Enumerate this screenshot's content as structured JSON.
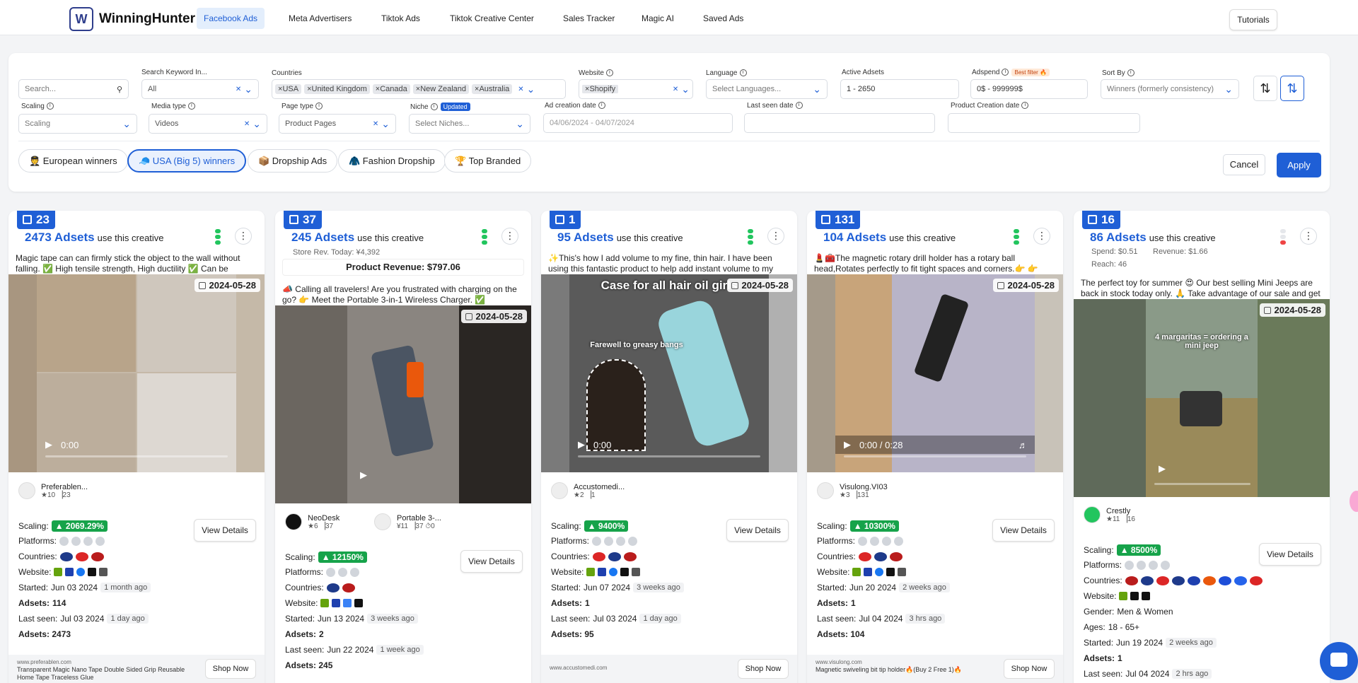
{
  "app": {
    "name": "WinningHunter",
    "tutorials": "Tutorials"
  },
  "nav": [
    "Facebook Ads",
    "Meta Advertisers",
    "Tiktok Ads",
    "Tiktok Creative Center",
    "Sales Tracker",
    "Magic AI",
    "Saved Ads"
  ],
  "filters": {
    "search_placeholder": "Search...",
    "keyword_label": "Search Keyword In...",
    "keyword_value": "All",
    "countries_label": "Countries",
    "countries": [
      "USA",
      "United Kingdom",
      "Canada",
      "New Zealand",
      "Australia"
    ],
    "website_label": "Website",
    "website": "Shopify",
    "language_label": "Language",
    "language_placeholder": "Select Languages...",
    "active_label": "Active Adsets",
    "active_value": "1 - 2650",
    "adspend_label": "Adspend",
    "best_filter": "Best filter 🔥",
    "adspend_value": "0$ - 999999$",
    "sortby_label": "Sort By",
    "sortby_value": "Winners (formerly consistency)",
    "scaling_label": "Scaling",
    "scaling_value": "Scaling",
    "media_label": "Media type",
    "media_value": "Videos",
    "pagetype_label": "Page type",
    "pagetype_value": "Product Pages",
    "niche_label": "Niche",
    "updated": "Updated",
    "niche_placeholder": "Select Niches...",
    "adcreation_label": "Ad creation date",
    "adcreation_value": "04/06/2024 - 04/07/2024",
    "lastseen_label": "Last seen date",
    "productcreation_label": "Product Creation date"
  },
  "presets": [
    "🧑‍✈️ European winners",
    "🧢 USA (Big 5) winners",
    "📦 Dropship Ads",
    "🧥 Fashion Dropship",
    "🏆 Top Branded"
  ],
  "buttons": {
    "cancel": "Cancel",
    "apply": "Apply",
    "view_details": "View Details",
    "shop_now": "Shop Now"
  },
  "labels": {
    "use_creative": "use this creative",
    "scaling": "Scaling:",
    "platforms": "Platforms:",
    "countries": "Countries:",
    "website": "Website:",
    "started": "Started:",
    "adsets": "Adsets:",
    "last_seen": "Last seen:",
    "gender": "Gender:",
    "ages": "Ages:"
  },
  "cards": [
    {
      "count": "23",
      "adsets": "2473 Adsets",
      "desc": "Magic tape can can firmly stick the object to the wall without falling. ✅ High tensile strength, High ductility ✅ Can be",
      "date": "2024-05-28",
      "time": "0:00",
      "advertiser": "Preferablen...",
      "adv_stats": "★10 ▕23",
      "scaling": "▲ 2069.29%",
      "started": "Jun 03 2024",
      "started_ago": "1 month ago",
      "adsets_n": "114",
      "last_seen": "Jul 03 2024",
      "last_ago": "1 day ago",
      "adsets_total": "Adsets: 2473",
      "foot_url": "www.preferablen.com",
      "foot_title": "Transparent Magic Nano Tape Double Sided Grip Reusable Home Tape Traceless Glue"
    },
    {
      "count": "37",
      "adsets": "245 Adsets",
      "store_rev": "Store Rev. Today: ¥4,392",
      "product_rev": "Product Revenue: $797.06",
      "desc": "📣 Calling all travelers! Are you frustrated with charging on the go? 👉 Meet the Portable 3-in-1 Wireless Charger. ✅",
      "date": "2024-05-28",
      "advertiser": "NeoDesk",
      "adv_stats": "★6 ▕37",
      "advertiser2": "Portable 3-...",
      "adv2_stats": "¥11 ▕37 ⏱0",
      "scaling": "▲ 12150%",
      "started": "Jun 13 2024",
      "started_ago": "3 weeks ago",
      "adsets_n": "2",
      "last_seen": "Jun 22 2024",
      "last_ago": "1 week ago",
      "adsets_total": "Adsets: 245"
    },
    {
      "count": "1",
      "adsets": "95 Adsets",
      "desc": "✨This's how I add volume to my fine, thin hair. I have been using this fantastic product to help add instant volume to my",
      "date": "2024-05-28",
      "overlay1": "Case for all hair oil girls",
      "overlay2": "Farewell to greasy bangs",
      "time": "0:00",
      "advertiser": "Accustomedi...",
      "adv_stats": "★2 ▕1",
      "scaling": "▲ 9400%",
      "started": "Jun 07 2024",
      "started_ago": "3 weeks ago",
      "adsets_n": "1",
      "last_seen": "Jul 03 2024",
      "last_ago": "1 day ago",
      "adsets_total": "Adsets: 95",
      "foot_url": "www.accustomedi.com"
    },
    {
      "count": "131",
      "adsets": "104 Adsets",
      "desc": "💄🧰The magnetic rotary drill holder has a rotary ball head,Rotates perfectly to fit tight spaces and corners.👉 👉",
      "date": "2024-05-28",
      "time": "0:00 / 0:28",
      "advertiser": "Visulong.VI03",
      "adv_stats": "★3 ▕131",
      "scaling": "▲ 10300%",
      "started": "Jun 20 2024",
      "started_ago": "2 weeks ago",
      "adsets_n": "1",
      "last_seen": "Jul 04 2024",
      "last_ago": "3 hrs ago",
      "adsets_total": "Adsets: 104",
      "foot_url": "www.visulong.com",
      "foot_title": "Magnetic swiveling bit tip holder🔥(Buy 2 Free 1)🔥"
    },
    {
      "count": "16",
      "adsets": "86 Adsets",
      "spend": "Spend: $0.51",
      "revenue": "Revenue: $1.66",
      "reach": "Reach: 46",
      "desc": "The perfect toy for summer 😍 Our best selling Mini Jeeps are back in stock today only. 🙏 Take advantage of our sale and get",
      "date": "2024-05-28",
      "overlay1": "4 margaritas = ordering a mini jeep",
      "advertiser": "Crestly",
      "adv_stats": "★11 ▕16",
      "scaling": "▲ 8500%",
      "gender": "Men & Women",
      "ages": "18 - 65+",
      "started": "Jun 19 2024",
      "started_ago": "2 weeks ago",
      "adsets_n": "1",
      "last_seen": "Jul 04 2024",
      "last_ago": "2 hrs ago"
    }
  ],
  "colors": {
    "primary": "#1f5fd6",
    "success": "#16a34a",
    "background": "#f3f4f6"
  }
}
